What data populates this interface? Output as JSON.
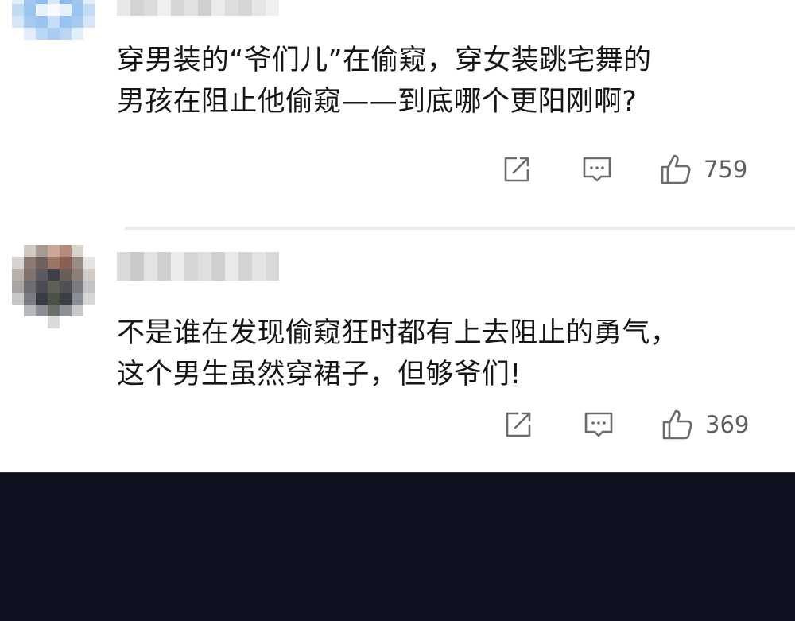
{
  "comments": [
    {
      "text": "穿男装的“爷们儿”在偷窥，穿女装跳宅舞的\n男孩在阻止他偷窥——到底哪个更阳刚啊?",
      "likes": "759"
    },
    {
      "text": "不是谁在发现偷窥狂时都有上去阻止的勇气，\n这个男生虽然穿裙子，但够爷们!",
      "likes": "369"
    }
  ],
  "icons": {
    "share": "share-icon",
    "reply": "reply-icon",
    "like": "thumbs-up-icon"
  },
  "colors": {
    "text": "#161616",
    "icon": "#6b6b6b",
    "bottom_bar": "#0f1221"
  }
}
